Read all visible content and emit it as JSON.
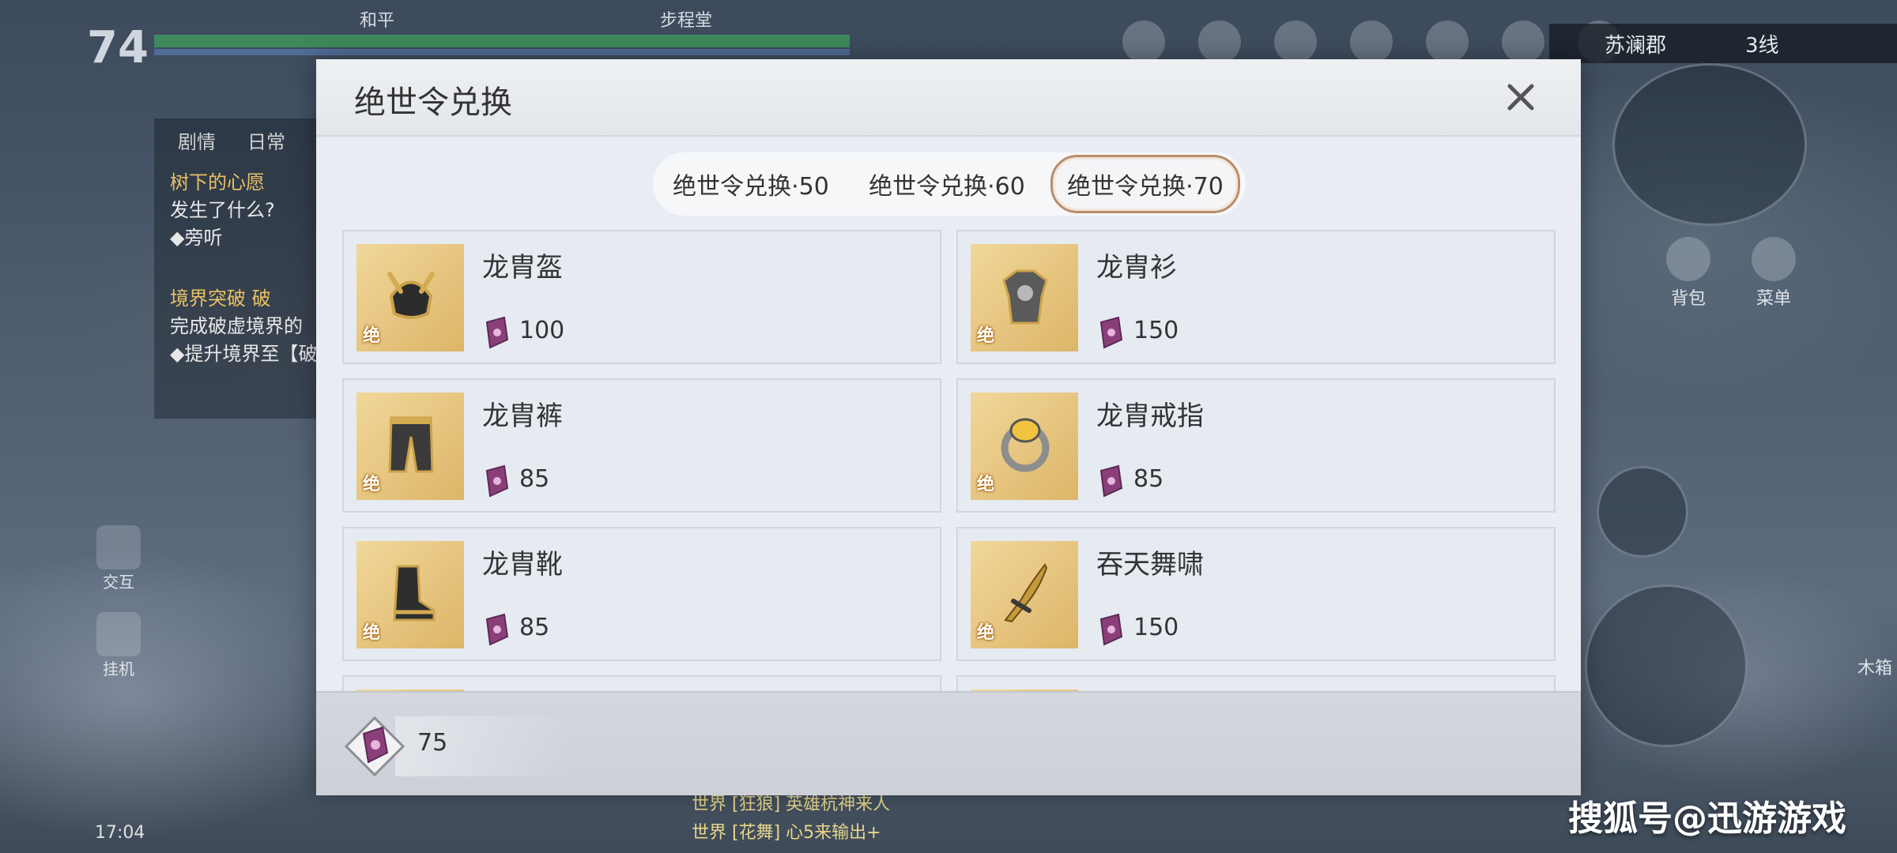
{
  "hud": {
    "level": "74",
    "top_labels": [
      "和平",
      "步程堂"
    ],
    "area_name": "苏澜郡",
    "line": "3线",
    "quest_tabs": [
      "剧情",
      "日常"
    ],
    "quests": [
      {
        "title": "树下的心愿",
        "desc": "发生了什么?",
        "sub": "◆旁听"
      },
      {
        "title": "境界突破 破",
        "desc": "完成破虚境界的",
        "sub": "◆提升境界至【破"
      }
    ],
    "left_buttons": [
      "交互",
      "挂机"
    ],
    "right_buttons": [
      "背包",
      "菜单"
    ],
    "right_side_text": "木箱",
    "time": "17:04",
    "chat": [
      "世界 [狂狼] 英雄杭神来人",
      "世界 [花舞] 心5来输出+"
    ]
  },
  "dialog": {
    "title": "绝世令兑换",
    "tabs": [
      {
        "label": "绝世令兑换·50",
        "active": false
      },
      {
        "label": "绝世令兑换·60",
        "active": false
      },
      {
        "label": "绝世令兑换·70",
        "active": true
      }
    ],
    "items": [
      {
        "name": "龙胄盔",
        "price": "100",
        "rank": "绝",
        "icon": "helmet-icon"
      },
      {
        "name": "龙胄衫",
        "price": "150",
        "rank": "绝",
        "icon": "armor-icon"
      },
      {
        "name": "龙胄裤",
        "price": "85",
        "rank": "绝",
        "icon": "pants-icon"
      },
      {
        "name": "龙胄戒指",
        "price": "85",
        "rank": "绝",
        "icon": "ring-icon"
      },
      {
        "name": "龙胄靴",
        "price": "85",
        "rank": "绝",
        "icon": "boots-icon"
      },
      {
        "name": "吞天舞啸",
        "price": "150",
        "rank": "绝",
        "icon": "blade-icon"
      }
    ],
    "currency_owned": "75"
  },
  "watermark": "搜狐号@迅游游戏",
  "colors": {
    "thumb_gold": "#e6c47a",
    "active_tab_border": "#b88d6c",
    "token_purple": "#8a3f7a"
  }
}
